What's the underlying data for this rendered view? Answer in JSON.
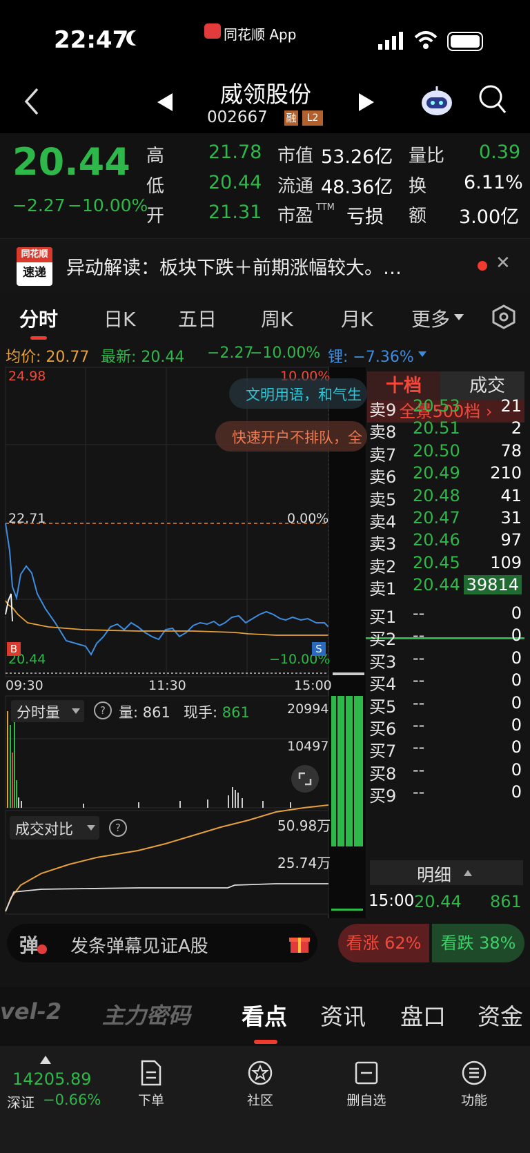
{
  "status_bar": {
    "time": "22:47",
    "app_label": "同花顺 App"
  },
  "header": {
    "stock_name": "威领股份",
    "stock_code": "002667",
    "badge1": "融",
    "badge2": "L2"
  },
  "quote": {
    "price": "20.44",
    "change": "−2.27",
    "change_pct": "−10.00%",
    "high_label": "高",
    "high": "21.78",
    "low_label": "低",
    "low": "20.44",
    "open_label": "开",
    "open": "21.31",
    "mktcap_label": "市值",
    "mktcap": "53.26亿",
    "float_label": "流通",
    "float": "48.36亿",
    "pe_label": "市盈",
    "pe_sup": "TTM",
    "pe": "亏损",
    "volratio_label": "量比",
    "volratio": "0.39",
    "turnover_label": "换",
    "turnover": "6.11%",
    "amount_label": "额",
    "amount": "3.00亿"
  },
  "banner": {
    "logo_top": "同花顺",
    "logo_bottom": "速递",
    "text": "异动解读：板块下跌＋前期涨幅较大。…",
    "close": "✕"
  },
  "tabs": [
    "分时",
    "日K",
    "五日",
    "周K",
    "月K",
    "更多"
  ],
  "info_line": {
    "avg_label": "均价: ",
    "avg": "20.77",
    "latest_label": "最新: ",
    "latest": "20.44",
    "chg": "−2.27",
    "pct": "−10.00%",
    "lock_label": "锂: ",
    "lock": "−7.36%"
  },
  "chart": {
    "top_price": "24.98",
    "top_pct": "10.00%",
    "mid_price": "22.71",
    "mid_pct": "0.00%",
    "bottom_price": "20.44",
    "bottom_pct": "−10.00%",
    "times": [
      "09:30",
      "11:30",
      "15:00"
    ],
    "marker_b": "B",
    "marker_s": "S",
    "overlay1": "文明用语，和气生",
    "overlay2": "快速开户不排队，全",
    "chart_data": {
      "type": "line",
      "x": [
        "09:30",
        "11:30",
        "15:00"
      ],
      "ylim": [
        20.44,
        24.98
      ],
      "series": []
    }
  },
  "volume": {
    "selector": "分时量",
    "vol_label": "量: ",
    "vol": "861",
    "cur_label": "现手: ",
    "cur": "861",
    "max": "20994",
    "mid": "10497"
  },
  "compare": {
    "selector": "成交对比",
    "top": "50.98万",
    "mid": "25.74万"
  },
  "orderbook": {
    "tab_active": "十档",
    "tab_other": "成交",
    "panorama": "全景500档 ›",
    "sells": [
      {
        "label": "卖9",
        "price": "20.53",
        "qty": "21"
      },
      {
        "label": "卖8",
        "price": "20.51",
        "qty": "2"
      },
      {
        "label": "卖7",
        "price": "20.50",
        "qty": "78"
      },
      {
        "label": "卖6",
        "price": "20.49",
        "qty": "210"
      },
      {
        "label": "卖5",
        "price": "20.48",
        "qty": "41"
      },
      {
        "label": "卖4",
        "price": "20.47",
        "qty": "31"
      },
      {
        "label": "卖3",
        "price": "20.46",
        "qty": "97"
      },
      {
        "label": "卖2",
        "price": "20.45",
        "qty": "109"
      },
      {
        "label": "卖1",
        "price": "20.44",
        "qty": "39814"
      }
    ],
    "buys": [
      {
        "label": "买1",
        "price": "--",
        "qty": "0"
      },
      {
        "label": "买2",
        "price": "--",
        "qty": "0"
      },
      {
        "label": "买3",
        "price": "--",
        "qty": "0"
      },
      {
        "label": "买4",
        "price": "--",
        "qty": "0"
      },
      {
        "label": "买5",
        "price": "--",
        "qty": "0"
      },
      {
        "label": "买6",
        "price": "--",
        "qty": "0"
      },
      {
        "label": "买7",
        "price": "--",
        "qty": "0"
      },
      {
        "label": "买8",
        "price": "--",
        "qty": "0"
      },
      {
        "label": "买9",
        "price": "--",
        "qty": "0"
      }
    ],
    "detail_label": "明细",
    "last_time": "15:00",
    "last_price": "20.44",
    "last_qty": "861"
  },
  "danmaku": {
    "icon": "弹",
    "placeholder": "发条弹幕见证A股",
    "up_label": "看涨 62%",
    "down_label": "看跌 38%"
  },
  "bottom_tabs": [
    "vel-2",
    "主力密码",
    "看点",
    "资讯",
    "盘口",
    "资金"
  ],
  "toolbar": {
    "index_value": "14205.89",
    "index_name": "深证",
    "index_pct": "−0.66%",
    "order": "下单",
    "community": "社区",
    "remove": "删自选",
    "functions": "功能"
  }
}
